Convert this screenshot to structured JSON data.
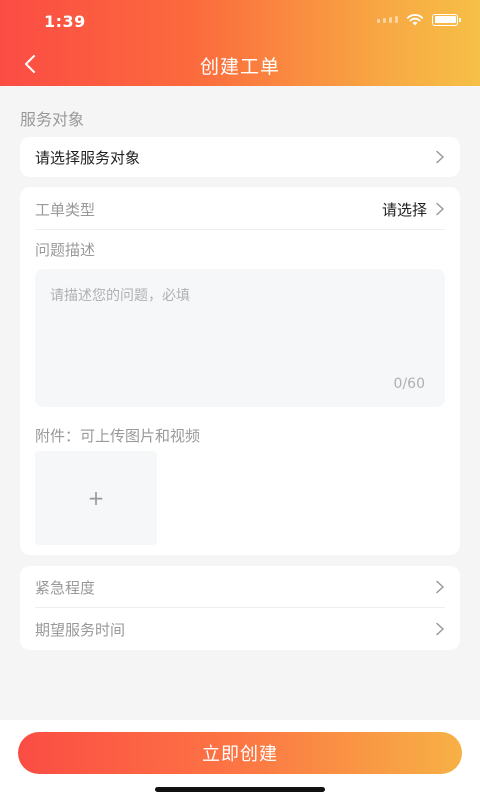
{
  "status_bar": {
    "time": "1:39"
  },
  "nav": {
    "title": "创建工单"
  },
  "service_target": {
    "section_title": "服务对象",
    "select_placeholder": "请选择服务对象"
  },
  "ticket_form": {
    "type_label": "工单类型",
    "type_value": "请选择",
    "description_label": "问题描述",
    "description_placeholder": "请描述您的问题，必填",
    "char_counter": "0/60",
    "attachment_label": "附件：可上传图片和视频",
    "upload_symbol": "+"
  },
  "extra": {
    "urgency_label": "紧急程度",
    "expected_time_label": "期望服务时间"
  },
  "submit": {
    "label": "立即创建"
  },
  "colors": {
    "accent_start": "#fb4c44",
    "accent_end": "#f6c046"
  },
  "icons": [
    "back-arrow-icon",
    "chevron-right-icon",
    "wifi-icon",
    "battery-icon",
    "signal-icon",
    "plus-icon"
  ]
}
